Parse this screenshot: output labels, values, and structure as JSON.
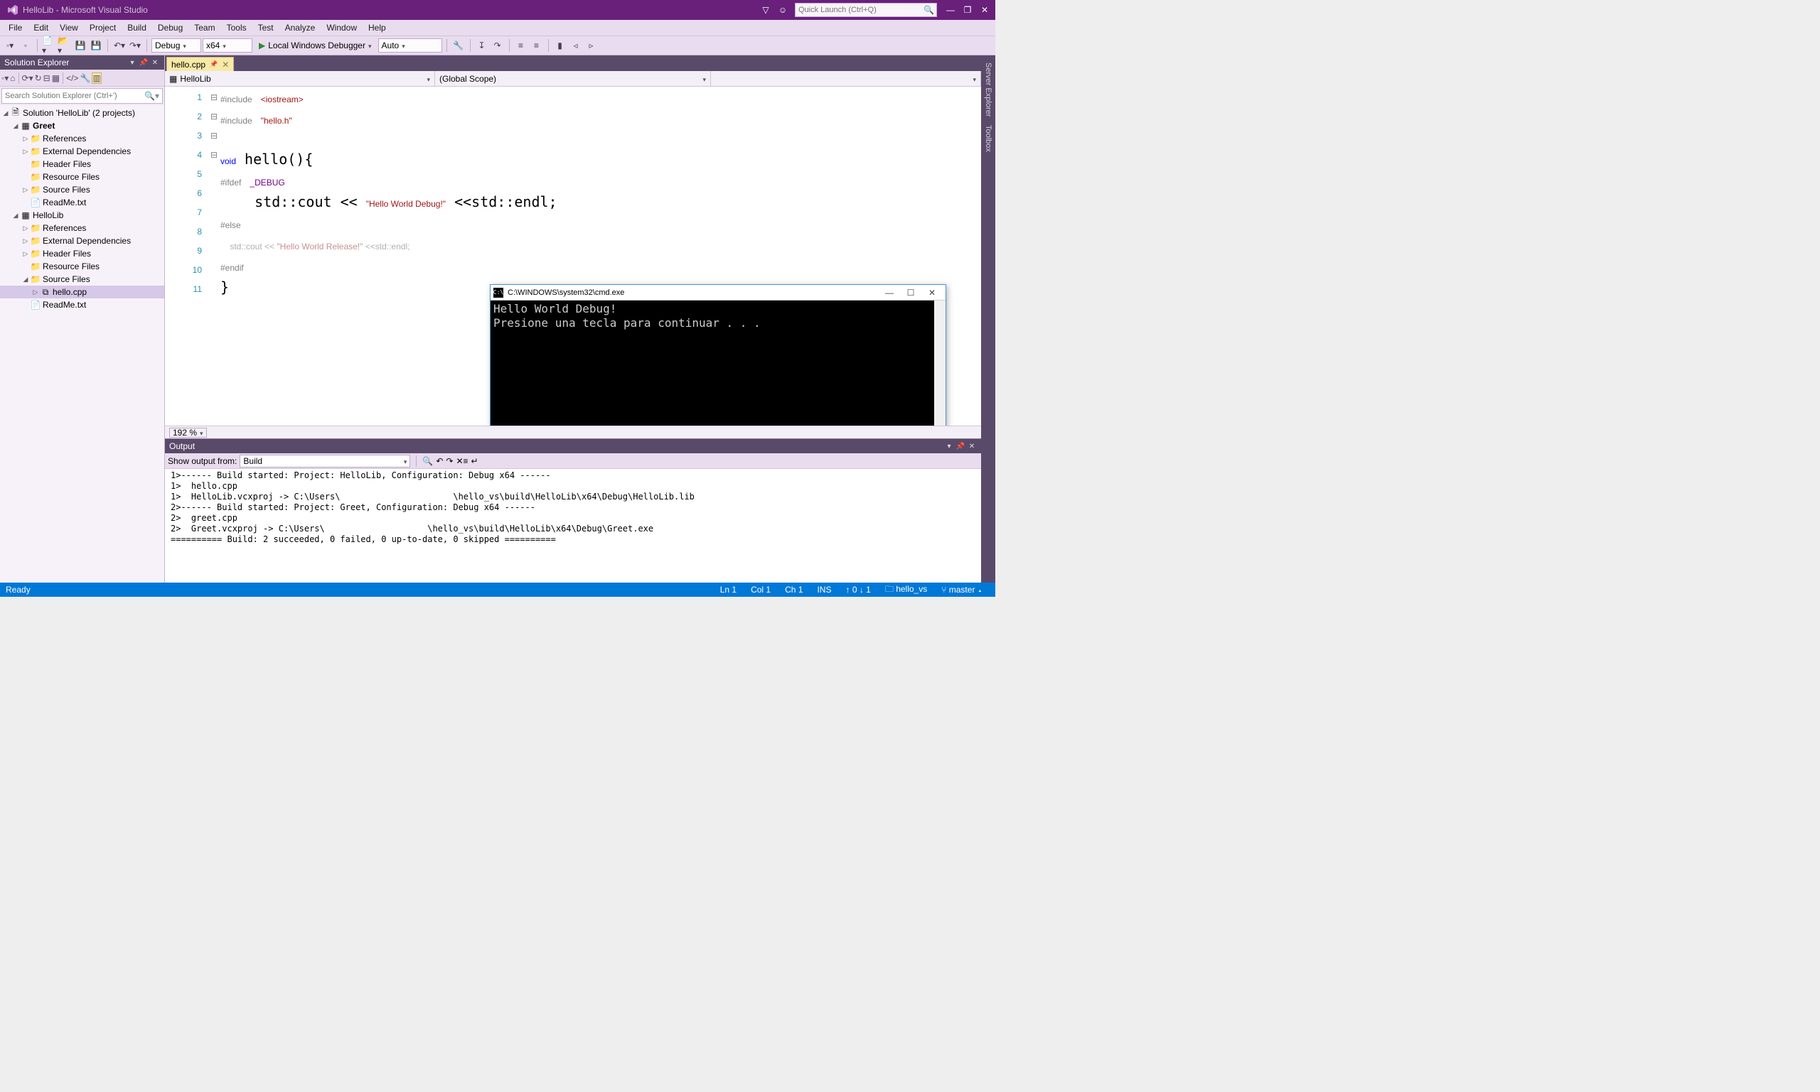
{
  "titlebar": {
    "title": "HelloLib - Microsoft Visual Studio",
    "quick_launch_placeholder": "Quick Launch (Ctrl+Q)"
  },
  "menubar": [
    "File",
    "Edit",
    "View",
    "Project",
    "Build",
    "Debug",
    "Team",
    "Tools",
    "Test",
    "Analyze",
    "Window",
    "Help"
  ],
  "toolbar": {
    "config": "Debug",
    "platform": "x64",
    "debugger": "Local Windows Debugger",
    "auto": "Auto"
  },
  "solution_explorer": {
    "title": "Solution Explorer",
    "search_placeholder": "Search Solution Explorer (Ctrl+')",
    "root": "Solution 'HelloLib' (2 projects)",
    "projects": [
      {
        "name": "Greet",
        "bold": true,
        "expanded": true,
        "children": [
          {
            "name": "References",
            "twisty": "▷"
          },
          {
            "name": "External Dependencies",
            "twisty": "▷"
          },
          {
            "name": "Header Files",
            "twisty": ""
          },
          {
            "name": "Resource Files",
            "twisty": ""
          },
          {
            "name": "Source Files",
            "twisty": "▷"
          },
          {
            "name": "ReadMe.txt",
            "twisty": ""
          }
        ]
      },
      {
        "name": "HelloLib",
        "bold": false,
        "expanded": true,
        "children": [
          {
            "name": "References",
            "twisty": "▷"
          },
          {
            "name": "External Dependencies",
            "twisty": "▷"
          },
          {
            "name": "Header Files",
            "twisty": "▷"
          },
          {
            "name": "Resource Files",
            "twisty": ""
          },
          {
            "name": "Source Files",
            "twisty": "◢",
            "expanded": true,
            "children": [
              {
                "name": "hello.cpp",
                "selected": true
              }
            ]
          },
          {
            "name": "ReadMe.txt",
            "twisty": ""
          }
        ]
      }
    ]
  },
  "editor": {
    "tab": "hello.cpp",
    "nav_left": "HelloLib",
    "nav_right": "(Global Scope)",
    "zoom": "192 %",
    "line_numbers": [
      "1",
      "2",
      "3",
      "4",
      "5",
      "6",
      "7",
      "8",
      "9",
      "10",
      "11"
    ],
    "folds": [
      "⊟",
      "",
      "",
      "⊟",
      "⊟",
      "",
      "⊟",
      "",
      "",
      "",
      ""
    ]
  },
  "console": {
    "title": "C:\\WINDOWS\\system32\\cmd.exe",
    "lines": [
      "Hello World Debug!",
      "Presione una tecla para continuar . . ."
    ]
  },
  "output": {
    "title": "Output",
    "from_label": "Show output from:",
    "from_value": "Build",
    "lines": [
      "1>------ Build started: Project: HelloLib, Configuration: Debug x64 ------",
      "1>  hello.cpp",
      "1>  HelloLib.vcxproj -> C:\\Users\\                      \\hello_vs\\build\\HelloLib\\x64\\Debug\\HelloLib.lib",
      "2>------ Build started: Project: Greet, Configuration: Debug x64 ------",
      "2>  greet.cpp",
      "2>  Greet.vcxproj -> C:\\Users\\                    \\hello_vs\\build\\HelloLib\\x64\\Debug\\Greet.exe",
      "========== Build: 2 succeeded, 0 failed, 0 up-to-date, 0 skipped =========="
    ]
  },
  "statusbar": {
    "ready": "Ready",
    "ln": "Ln 1",
    "col": "Col 1",
    "ch": "Ch 1",
    "ins": "INS",
    "pub": "↑ 0  ↓ 1",
    "repo": "hello_vs",
    "branch": "master"
  },
  "right_rail": [
    "Server Explorer",
    "Toolbox"
  ]
}
